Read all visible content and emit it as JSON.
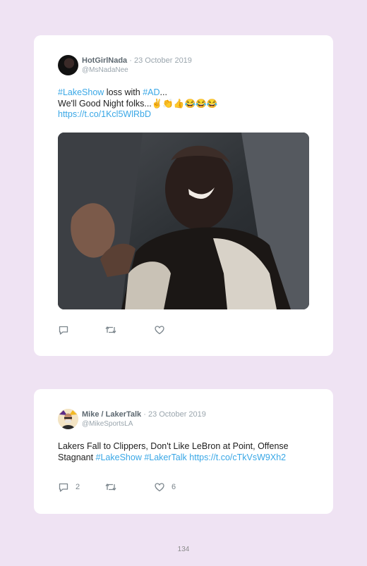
{
  "tweets": [
    {
      "author_name": "HotGirlNada",
      "date": "· 23 October 2019",
      "handle": "@MsNadaNee",
      "text": {
        "line1_tag1": "#LakeShow",
        "line1_mid": " loss with ",
        "line1_tag2": "#AD",
        "line1_end": "...",
        "line2": "We'll Good Night folks...✌️👏👍😂😂😂",
        "link": "https://t.co/1Kcl5WlRbD"
      },
      "media_icon": "video-frame-person-laughing",
      "actions": {
        "reply_count": "",
        "retweet_count": "",
        "like_count": ""
      }
    },
    {
      "author_name": "Mike / LakerTalk",
      "date": "· 23 October 2019",
      "handle": "@MikeSportsLA",
      "text": {
        "line1": "Lakers Fall to Clippers, Don't Like LeBron at Point, Offense",
        "line2_start": "Stagnant ",
        "tag1": "#LakeShow",
        "tag2": "#LakerTalk",
        "link": "https://t.co/cTkVsW9Xh2"
      },
      "actions": {
        "reply_count": "2",
        "retweet_count": "",
        "like_count": "6"
      }
    }
  ],
  "page_number": "134",
  "colors": {
    "background": "#efe3f3",
    "card": "#ffffff",
    "link": "#39a7e6",
    "muted": "#9aa5ad"
  }
}
